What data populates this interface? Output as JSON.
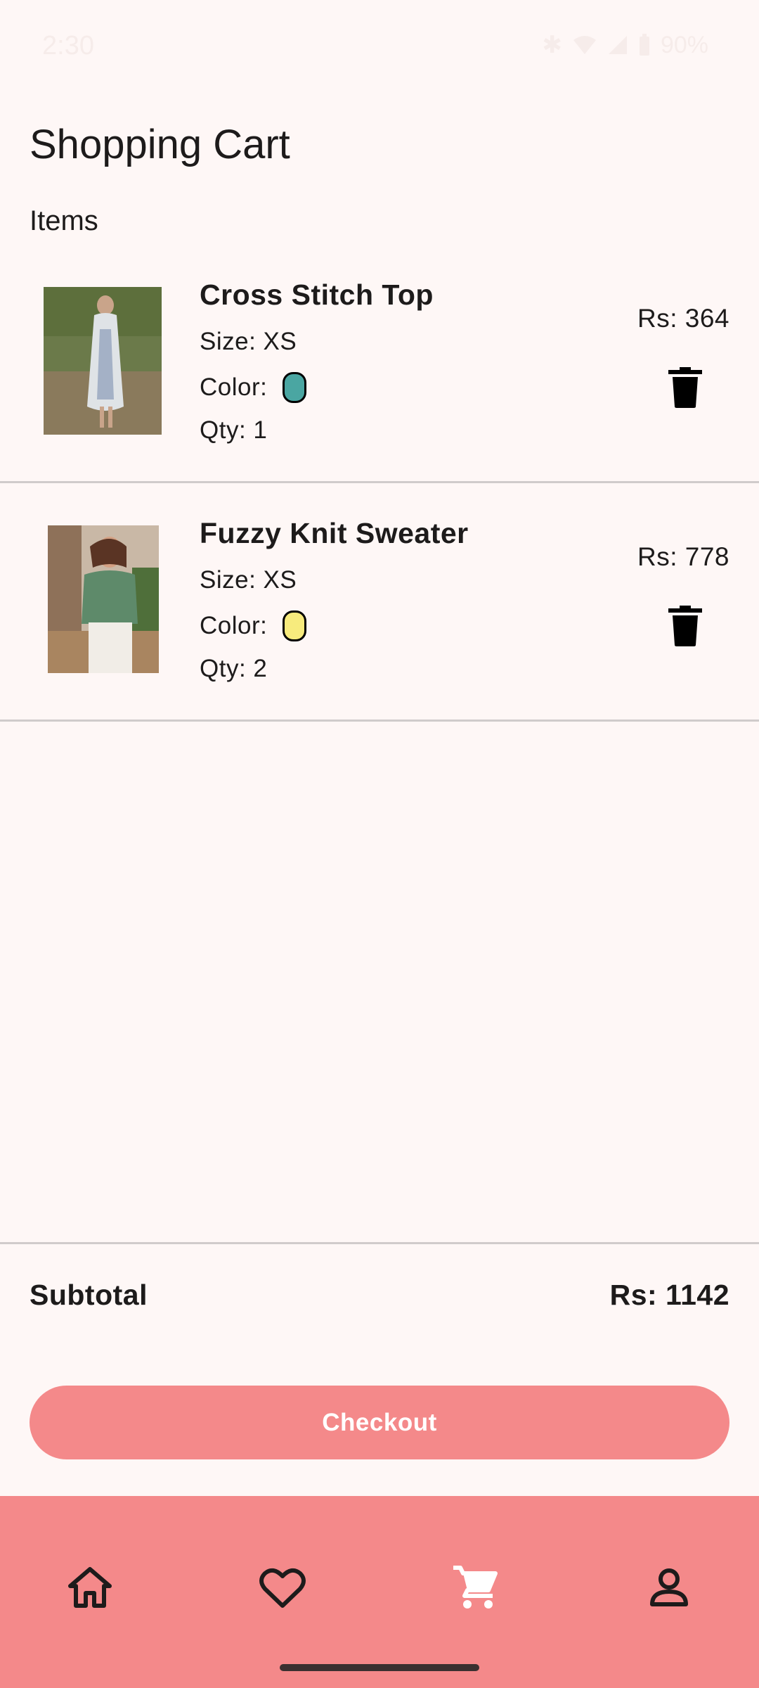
{
  "status_bar": {
    "time": "2:30",
    "battery": "90%",
    "icons": [
      "bluetooth-icon",
      "wifi-icon",
      "signal-icon",
      "battery-icon"
    ]
  },
  "header": {
    "title": "Shopping Cart",
    "section_label": "Items"
  },
  "cart": {
    "items": [
      {
        "name": "Cross Stitch Top",
        "size": "Size: XS",
        "color_label": "Color:",
        "color_hex": "#4aa6a2",
        "qty": "Qty: 1",
        "price": "Rs: 364"
      },
      {
        "name": "Fuzzy Knit Sweater",
        "size": "Size: XS",
        "color_label": "Color:",
        "color_hex": "#f7eb7d",
        "qty": "Qty: 2",
        "price": "Rs: 778"
      }
    ]
  },
  "summary": {
    "subtotal_label": "Subtotal",
    "subtotal_value": "Rs: 1142",
    "checkout_label": "Checkout"
  },
  "nav": {
    "items": [
      "home-icon",
      "heart-icon",
      "cart-icon",
      "profile-icon"
    ],
    "active": "cart-icon"
  },
  "colors": {
    "background": "#fef7f6",
    "accent": "#f4898a",
    "nav_active_icon": "#ffffff",
    "nav_icon": "#1d1b1b"
  }
}
